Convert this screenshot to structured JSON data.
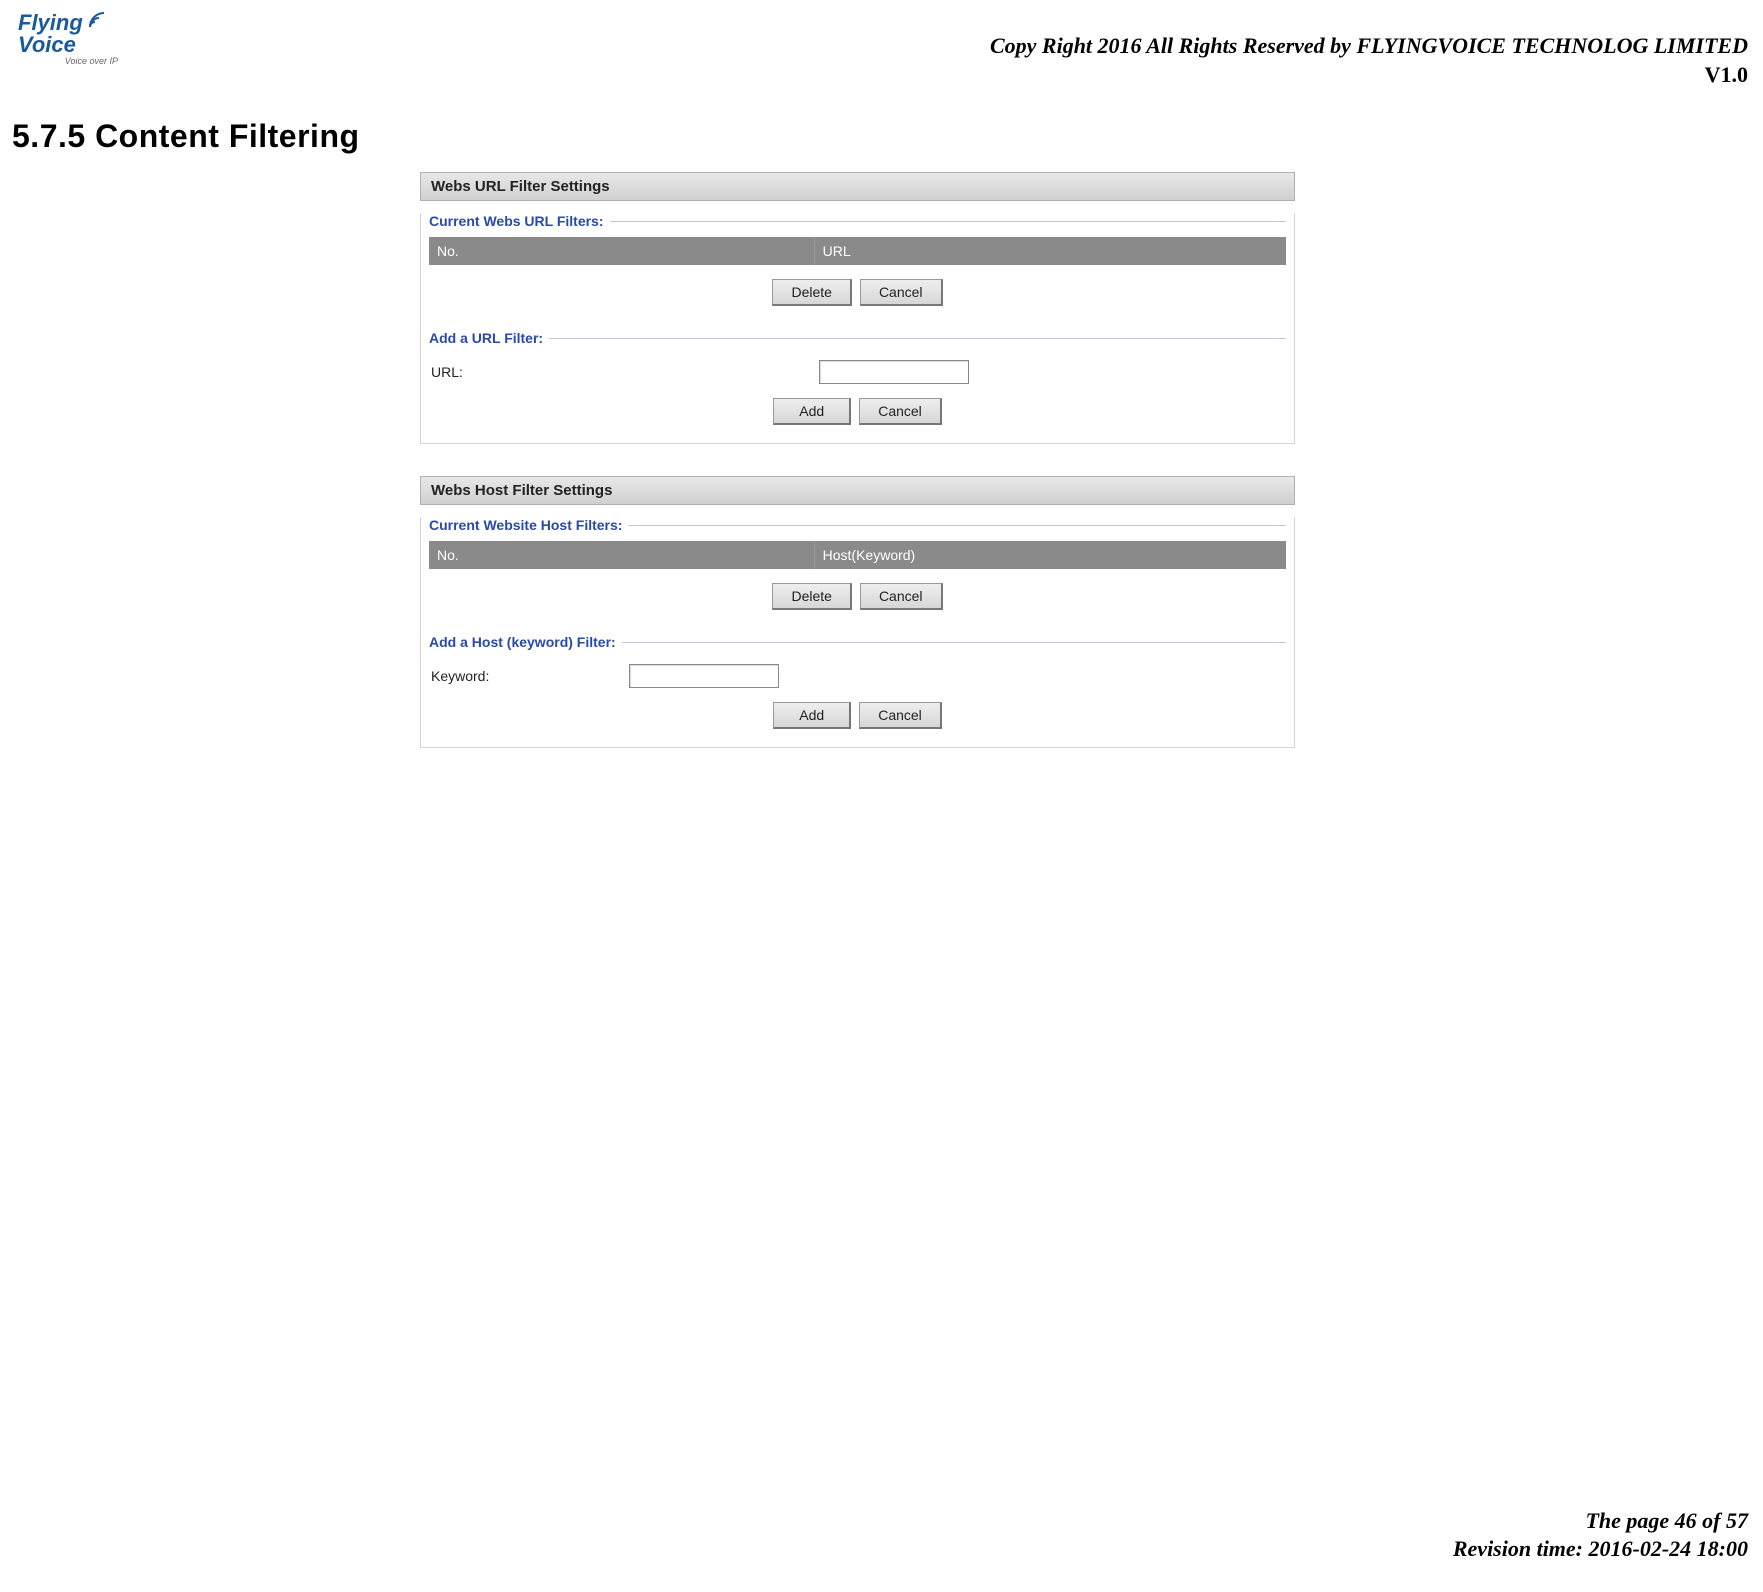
{
  "logo": {
    "line1": "Flying",
    "line2": "Voice",
    "tagline": "Voice over IP"
  },
  "header": {
    "copyright": "Copy Right 2016 All Rights Reserved by FLYINGVOICE TECHNOLOG LIMITED",
    "version": "V1.0"
  },
  "section_heading": "5.7.5 Content Filtering",
  "url_filter": {
    "panel_title": "Webs URL Filter Settings",
    "current_legend": "Current Webs URL Filters:",
    "table_cols": {
      "no": "No.",
      "url": "URL"
    },
    "buttons": {
      "delete": "Delete",
      "cancel": "Cancel"
    },
    "add_legend": "Add a URL Filter:",
    "add_label": "URL:",
    "add_value": "",
    "add_buttons": {
      "add": "Add",
      "cancel": "Cancel"
    }
  },
  "host_filter": {
    "panel_title": "Webs Host Filter Settings",
    "current_legend": "Current Website Host Filters:",
    "table_cols": {
      "no": "No.",
      "host": "Host(Keyword)"
    },
    "buttons": {
      "delete": "Delete",
      "cancel": "Cancel"
    },
    "add_legend": "Add a Host (keyword) Filter:",
    "add_label": "Keyword:",
    "add_value": "",
    "add_buttons": {
      "add": "Add",
      "cancel": "Cancel"
    }
  },
  "footer": {
    "page": "The page 46 of 57",
    "revision": "Revision time: 2016-02-24 18:00"
  }
}
